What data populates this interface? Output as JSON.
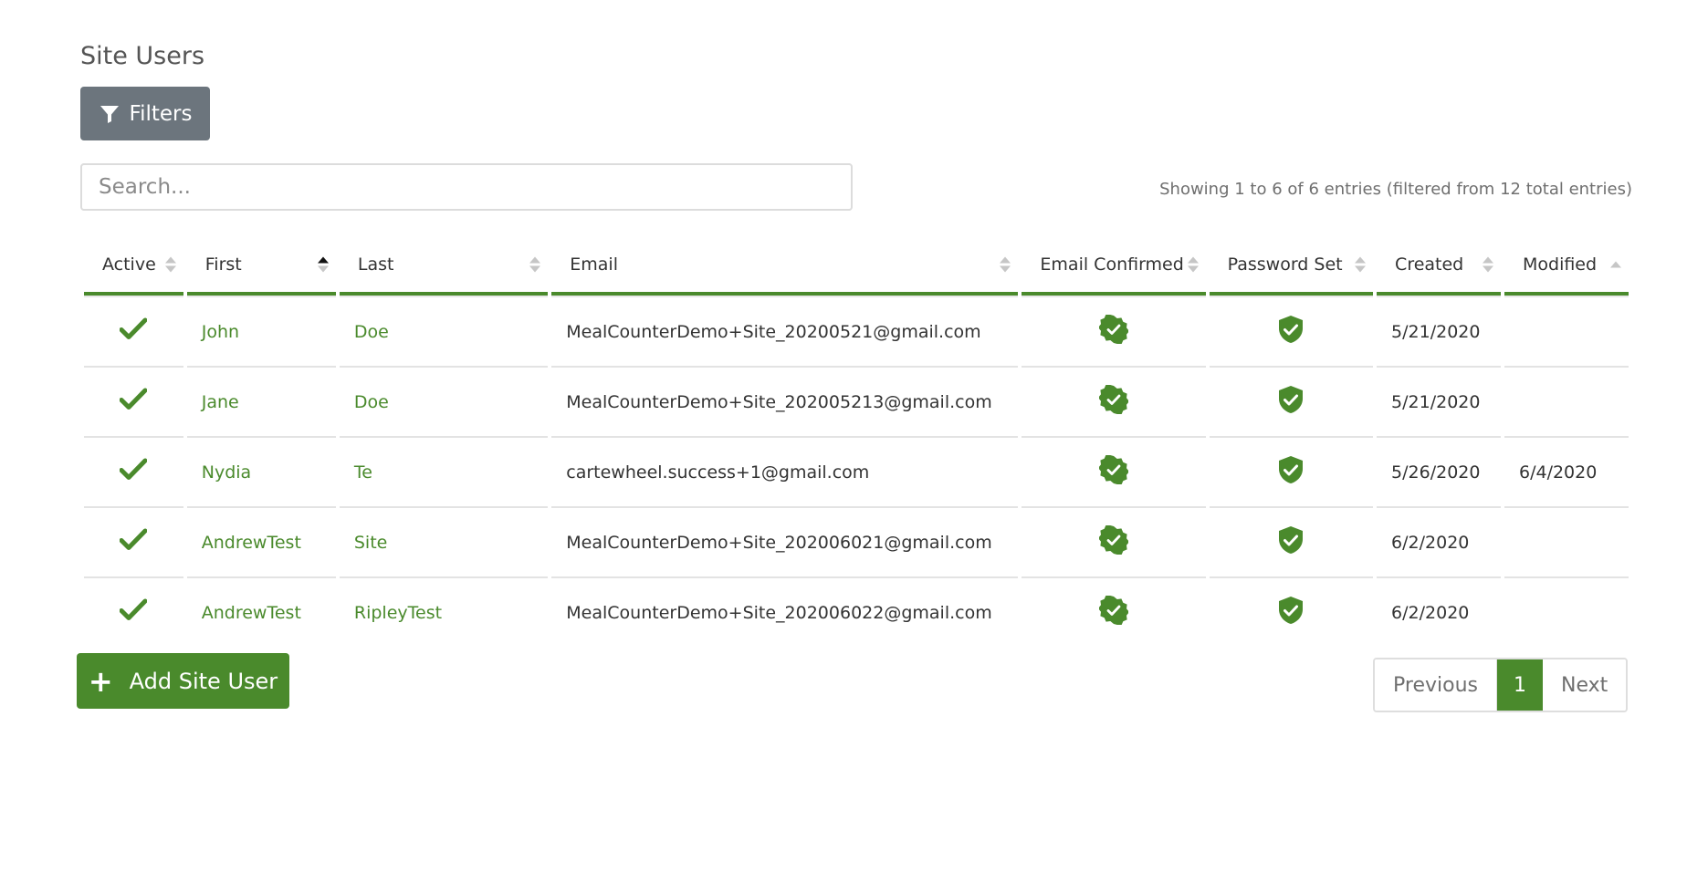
{
  "page": {
    "title": "Site Users"
  },
  "toolbar": {
    "filters_label": "Filters"
  },
  "search": {
    "placeholder": "Search...",
    "value": ""
  },
  "info": {
    "entries_text": "Showing 1 to 6 of 6 entries (filtered from 12 total entries)"
  },
  "table": {
    "columns": [
      {
        "key": "active",
        "label": "Active",
        "sort": "none"
      },
      {
        "key": "first",
        "label": "First",
        "sort": "asc"
      },
      {
        "key": "last",
        "label": "Last",
        "sort": "none"
      },
      {
        "key": "email",
        "label": "Email",
        "sort": "none"
      },
      {
        "key": "email_confirmed",
        "label": "Email Confirmed",
        "sort": "none"
      },
      {
        "key": "password_set",
        "label": "Password Set",
        "sort": "none"
      },
      {
        "key": "created",
        "label": "Created",
        "sort": "none"
      },
      {
        "key": "modified",
        "label": "Modified",
        "sort": "asc-dim"
      }
    ],
    "rows": [
      {
        "active": true,
        "first": "John",
        "last": "Doe",
        "email": "MealCounterDemo+Site_20200521@gmail.com",
        "email_confirmed": true,
        "password_set": true,
        "created": "5/21/2020",
        "modified": ""
      },
      {
        "active": true,
        "first": "Jane",
        "last": "Doe",
        "email": "MealCounterDemo+Site_202005213@gmail.com",
        "email_confirmed": true,
        "password_set": true,
        "created": "5/21/2020",
        "modified": ""
      },
      {
        "active": true,
        "first": "Nydia",
        "last": "Te",
        "email": "cartewheel.success+1@gmail.com",
        "email_confirmed": true,
        "password_set": true,
        "created": "5/26/2020",
        "modified": "6/4/2020"
      },
      {
        "active": true,
        "first": "AndrewTest",
        "last": "Site",
        "email": "MealCounterDemo+Site_202006021@gmail.com",
        "email_confirmed": true,
        "password_set": true,
        "created": "6/2/2020",
        "modified": ""
      },
      {
        "active": true,
        "first": "AndrewTest",
        "last": "RipleyTest",
        "email": "MealCounterDemo+Site_202006022@gmail.com",
        "email_confirmed": true,
        "password_set": true,
        "created": "6/2/2020",
        "modified": ""
      }
    ]
  },
  "actions": {
    "add_label": "Add Site User"
  },
  "pagination": {
    "previous_label": "Previous",
    "current_page": "1",
    "next_label": "Next"
  },
  "colors": {
    "accent": "#4a8a2c",
    "secondary_button": "#6c757d"
  },
  "icons": {
    "filter": "filter-icon",
    "active": "checkmark-icon",
    "email_confirmed": "badge-check-icon",
    "password_set": "shield-check-icon",
    "add": "plus-icon"
  }
}
